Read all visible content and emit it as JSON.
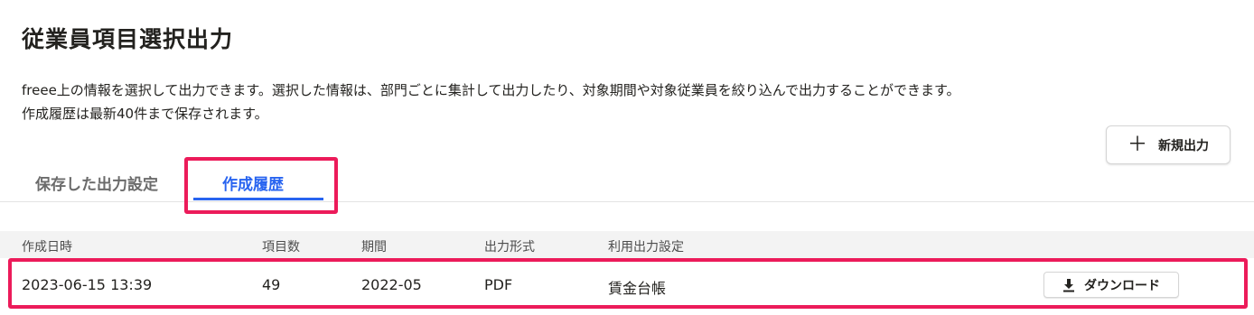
{
  "page": {
    "title": "従業員項目選択出力",
    "description_line1": "freee上の情報を選択して出力できます。選択した情報は、部門ごとに集計して出力したり、対象期間や対象従業員を絞り込んで出力することができます。",
    "description_line2": "作成履歴は最新40件まで保存されます。"
  },
  "toolbar": {
    "new_output_label": "新規出力",
    "new_output_icon": "plus-icon"
  },
  "tabs": [
    {
      "label": "保存した出力設定",
      "active": false
    },
    {
      "label": "作成履歴",
      "active": true
    }
  ],
  "table": {
    "columns": [
      "作成日時",
      "項目数",
      "期間",
      "出力形式",
      "利用出力設定"
    ],
    "rows": [
      {
        "created_at": "2023-06-15 13:39",
        "item_count": "49",
        "period": "2022-05",
        "format": "PDF",
        "setting": "賃金台帳",
        "download_label": "ダウンロード"
      }
    ]
  },
  "colors": {
    "accent": "#2864f0",
    "highlight": "#ec1b5a",
    "text": "#23221f"
  }
}
